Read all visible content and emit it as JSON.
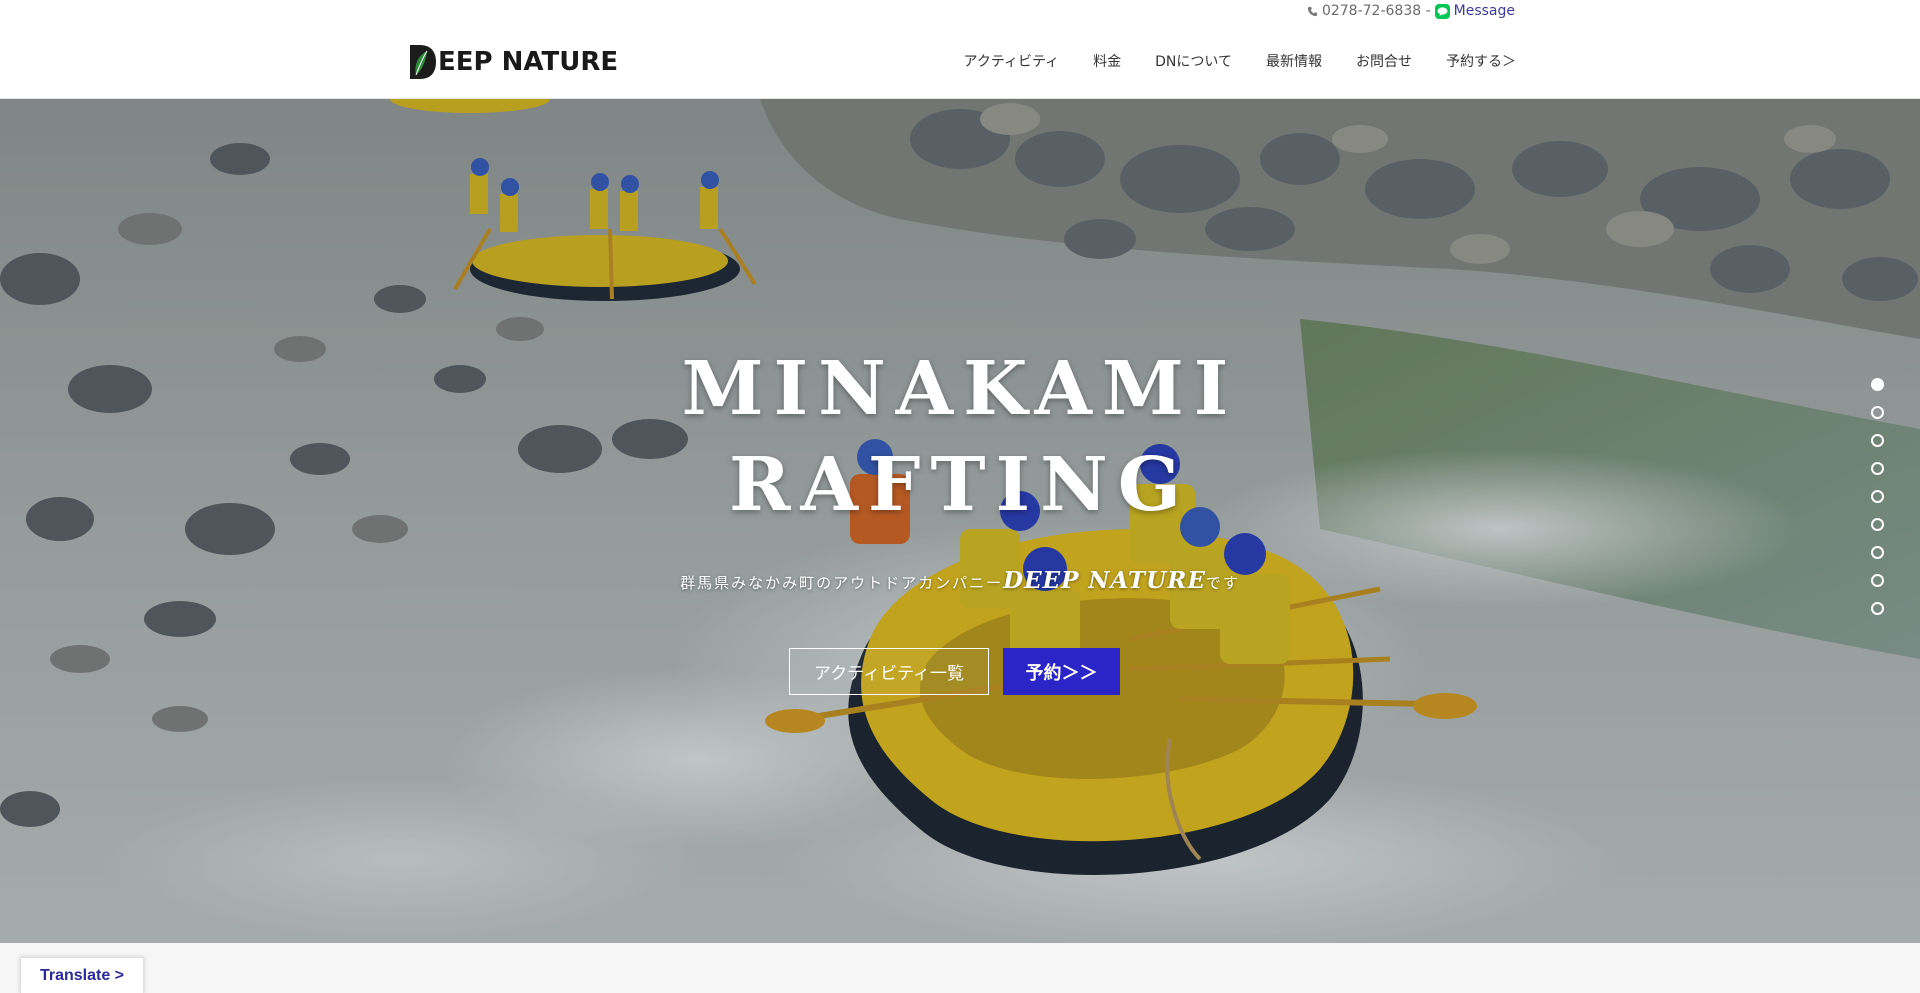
{
  "topbar": {
    "phone": "0278-72-6838 -",
    "message_label": "Message"
  },
  "logo": {
    "text": "EEP NATURE",
    "initial": "D"
  },
  "nav": {
    "items": [
      {
        "label": "アクティビティ"
      },
      {
        "label": "料金"
      },
      {
        "label": "DNについて"
      },
      {
        "label": "最新情報"
      },
      {
        "label": "お問合せ"
      },
      {
        "label": "予約する＞"
      }
    ]
  },
  "hero": {
    "title_line1": "MINAKAMI",
    "title_line2": "RAFTING",
    "sub_prefix": "群馬県みなかみ町のアウトドアカンパニー",
    "sub_brand": "DEEP NATURE",
    "sub_suffix": "です",
    "btn_activities": "アクティビティ一覧",
    "btn_reserve": "予約＞＞",
    "slide_count": 9,
    "active_slide": 1
  },
  "translate": {
    "label": "Translate >"
  },
  "colors": {
    "accent": "#2b24c6",
    "raft_yellow": "#f2c81b",
    "line_green": "#06c755"
  },
  "icons": [
    "phone-icon",
    "line-icon",
    "logo-leaf-icon"
  ]
}
